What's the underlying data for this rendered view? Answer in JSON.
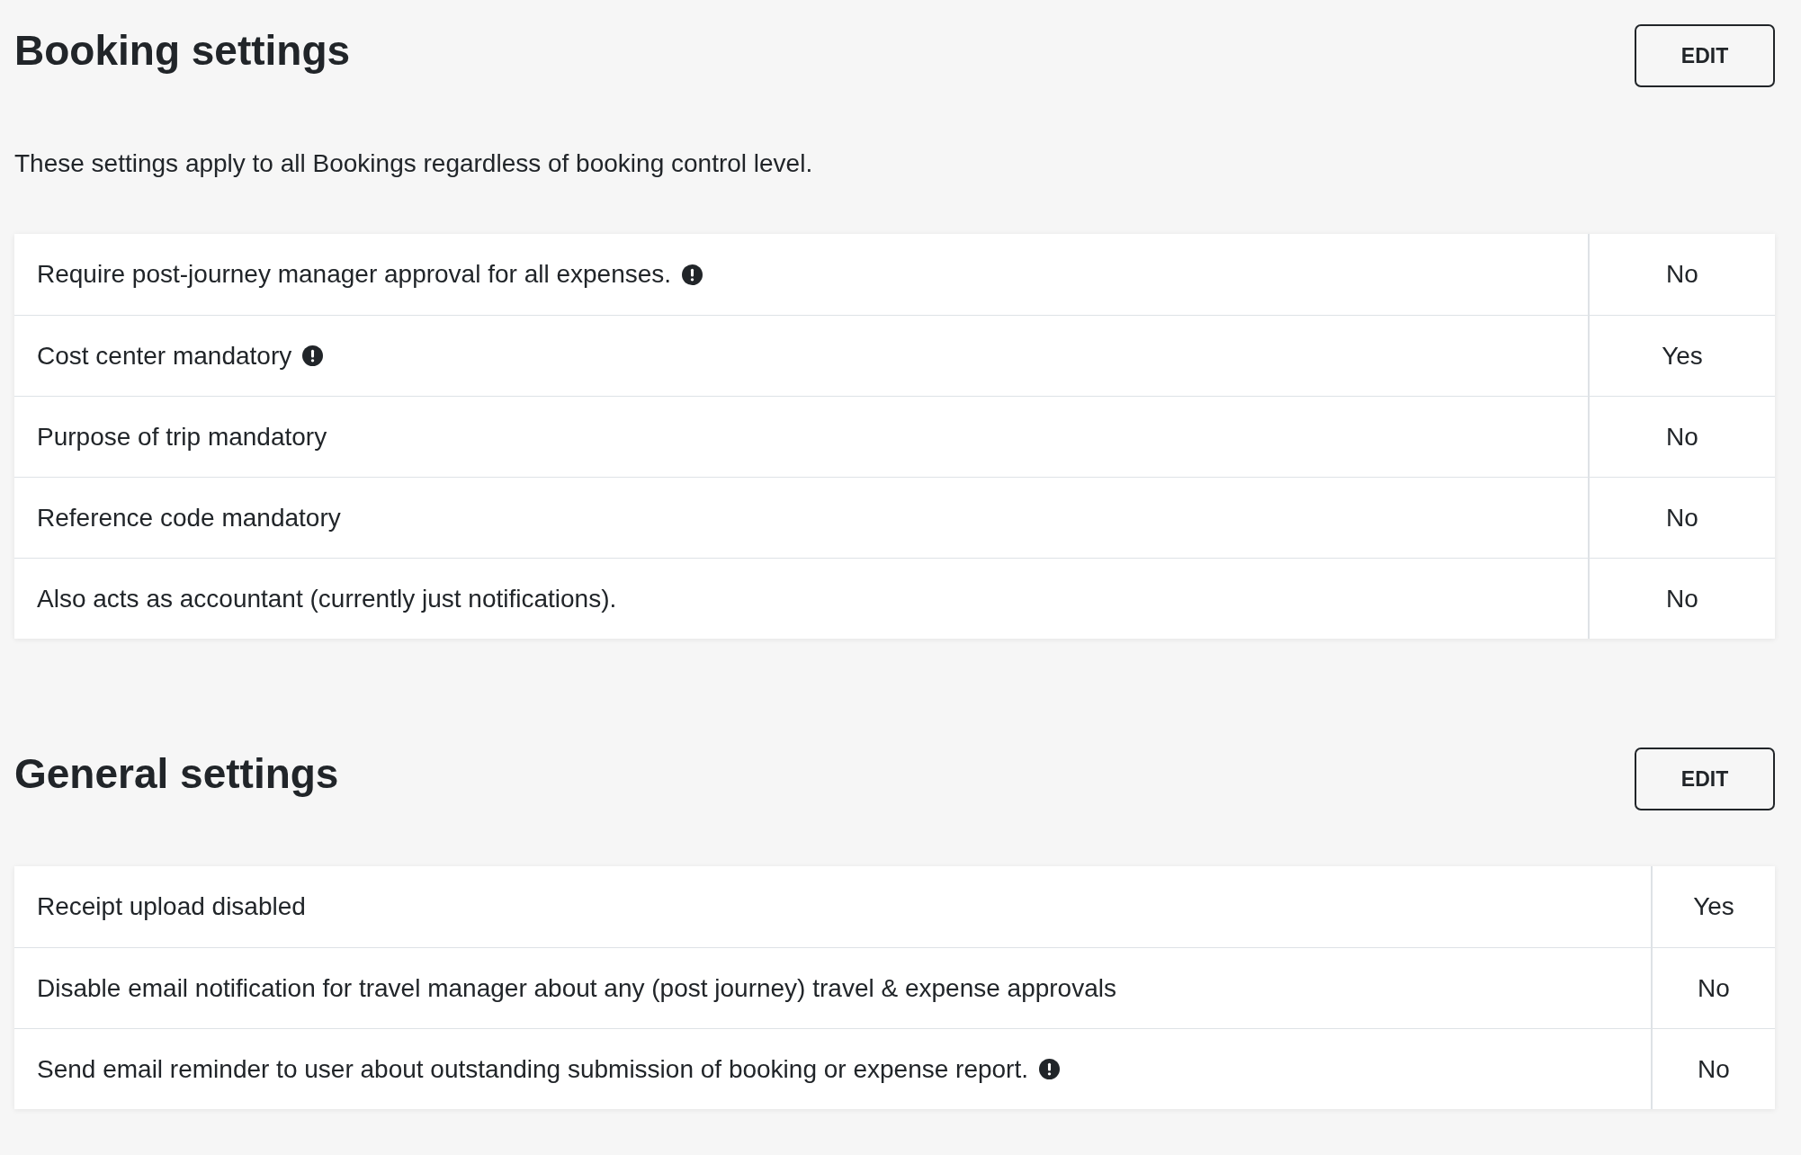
{
  "sections": [
    {
      "title": "Booking settings",
      "edit_button": "EDIT",
      "description": "These settings apply to all Bookings regardless of booking control level.",
      "rows": [
        {
          "label": "Require post-journey manager approval for all expenses.",
          "info": true,
          "value": "No"
        },
        {
          "label": "Cost center mandatory",
          "info": true,
          "value": "Yes"
        },
        {
          "label": "Purpose of trip mandatory",
          "info": false,
          "value": "No"
        },
        {
          "label": "Reference code mandatory",
          "info": false,
          "value": "No"
        },
        {
          "label": "Also acts as accountant (currently just notifications).",
          "info": false,
          "value": "No"
        }
      ]
    },
    {
      "title": "General settings",
      "edit_button": "EDIT",
      "rows": [
        {
          "label": "Receipt upload disabled",
          "info": false,
          "value": "Yes"
        },
        {
          "label": "Disable email notification for travel manager about any (post journey) travel & expense approvals",
          "info": false,
          "value": "No"
        },
        {
          "label": "Send email reminder to user about outstanding submission of booking or expense report.",
          "info": true,
          "value": "No"
        }
      ]
    }
  ]
}
